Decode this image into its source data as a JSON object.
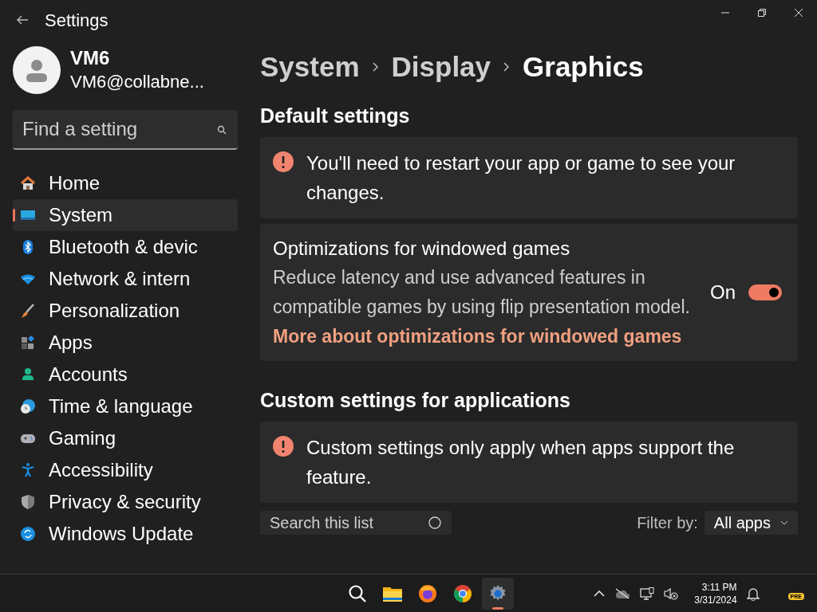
{
  "window": {
    "title": "Settings"
  },
  "user": {
    "name": "VM6",
    "email": "VM6@collabne..."
  },
  "search": {
    "placeholder": "Find a setting"
  },
  "nav": [
    {
      "kind": "home",
      "label": "Home",
      "selected": false
    },
    {
      "kind": "system",
      "label": "System",
      "selected": true
    },
    {
      "kind": "bluetooth",
      "label": "Bluetooth & devic",
      "selected": false
    },
    {
      "kind": "network",
      "label": "Network & intern",
      "selected": false
    },
    {
      "kind": "personalization",
      "label": "Personalization",
      "selected": false
    },
    {
      "kind": "apps",
      "label": "Apps",
      "selected": false
    },
    {
      "kind": "accounts",
      "label": "Accounts",
      "selected": false
    },
    {
      "kind": "time",
      "label": "Time & language",
      "selected": false
    },
    {
      "kind": "gaming",
      "label": "Gaming",
      "selected": false
    },
    {
      "kind": "accessibility",
      "label": "Accessibility",
      "selected": false
    },
    {
      "kind": "privacy",
      "label": "Privacy & security",
      "selected": false
    },
    {
      "kind": "update",
      "label": "Windows Update",
      "selected": false
    }
  ],
  "breadcrumb": [
    "System",
    "Display",
    "Graphics"
  ],
  "sections": [
    {
      "title": "Default settings",
      "cards": [
        {
          "kind": "info",
          "text": "You'll need to restart your app or game to see your changes."
        },
        {
          "kind": "toggle",
          "title": "Optimizations for windowed games",
          "description": "Reduce latency and use advanced features in compatible games by using flip presentation model.",
          "link": "More about optimizations for windowed games",
          "state_label": "On",
          "on": true
        }
      ]
    },
    {
      "title": "Custom settings for applications",
      "cards": [
        {
          "kind": "info",
          "text": "Custom settings only apply when apps support the feature."
        }
      ]
    }
  ],
  "app_list": {
    "search_placeholder": "Search this list",
    "filter_label": "Filter by:",
    "filter_value": "All apps"
  },
  "taskbar": {
    "apps": [
      {
        "kind": "search",
        "selected": false
      },
      {
        "kind": "folder",
        "selected": false
      },
      {
        "kind": "firefox",
        "selected": false
      },
      {
        "kind": "chrome",
        "selected": false
      },
      {
        "kind": "settings",
        "selected": true
      }
    ],
    "time": "3:11 PM",
    "date": "3/31/2024",
    "badge": "PRE"
  }
}
